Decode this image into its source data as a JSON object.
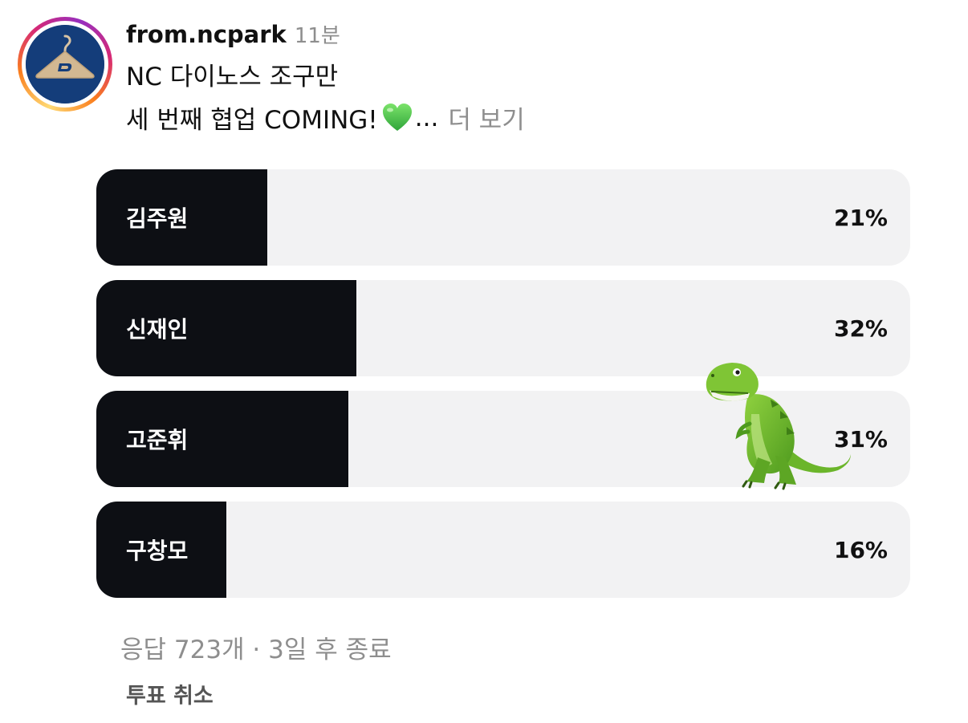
{
  "post": {
    "username": "from.ncpark",
    "time": "11분",
    "caption_line1": "NC 다이노스 조구만",
    "caption_line2": "세 번째 협업 COMING!",
    "caption_emoji": "green-heart-icon",
    "ellipsis": "...",
    "more_label": "더 보기",
    "avatar_icon": "hanger-logo-icon"
  },
  "poll": {
    "options": [
      {
        "label": "김주원",
        "percent": "21%",
        "value": 21
      },
      {
        "label": "신재인",
        "percent": "32%",
        "value": 32
      },
      {
        "label": "고준휘",
        "percent": "31%",
        "value": 31
      },
      {
        "label": "구창모",
        "percent": "16%",
        "value": 16
      }
    ],
    "stats": "응답 723개 · 3일 후 종료",
    "cancel_label": "투표 취소",
    "sticker_icon": "t-rex-icon"
  },
  "colors": {
    "fill": "#0d0f14",
    "track": "#f2f2f3",
    "muted": "#8e8e8e",
    "avatar_bg": "#143d7a"
  }
}
